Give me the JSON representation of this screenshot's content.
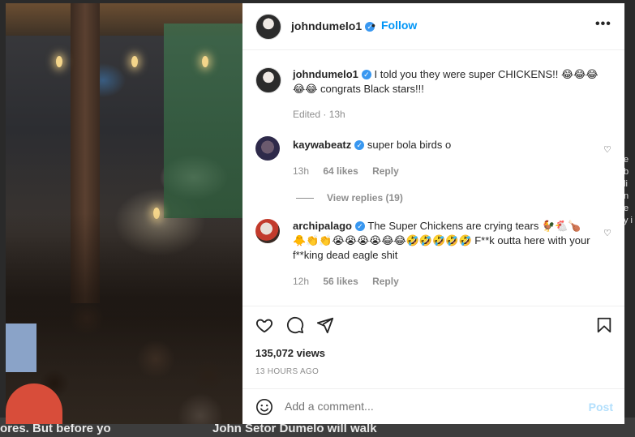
{
  "post": {
    "username": "johndumelo1",
    "follow_label": "Follow",
    "separator": "•",
    "more_icon": "more-horizontal-icon",
    "verified_icon": "verified-badge-icon"
  },
  "caption": {
    "username": "johndumelo1",
    "text": "I told you they were super CHICKENS!! 😂😂😂😂😂 congrats Black stars!!!",
    "edited": "Edited · 13h"
  },
  "comments": [
    {
      "username": "kaywabeatz",
      "text": "super bola birds o",
      "time": "13h",
      "likes": "64 likes",
      "reply_label": "Reply",
      "view_replies": "View replies (19)"
    },
    {
      "username": "archipalago",
      "text": "The Super Chickens are crying tears 🐓🐔🍗🐥👏👏😭😭😭😭😂😂🤣🤣🤣🤣🤣 F**k outta here with your f**king dead eagle shit",
      "time": "12h",
      "likes": "56 likes",
      "reply_label": "Reply"
    }
  ],
  "stats": {
    "views": "135,072 views",
    "time_ago": "13 HOURS AGO"
  },
  "composer": {
    "placeholder": "Add a comment...",
    "post_label": "Post"
  },
  "background": {
    "caption_left": "ores. But before yo",
    "caption_mid": "John Setor Dumelo will walk",
    "right_text": "e b li n e y i"
  },
  "colors": {
    "accent": "#0095f6",
    "verified": "#3897f0",
    "post_disabled": "#b2dffc",
    "text": "#262626",
    "muted": "#8e8e8e"
  }
}
